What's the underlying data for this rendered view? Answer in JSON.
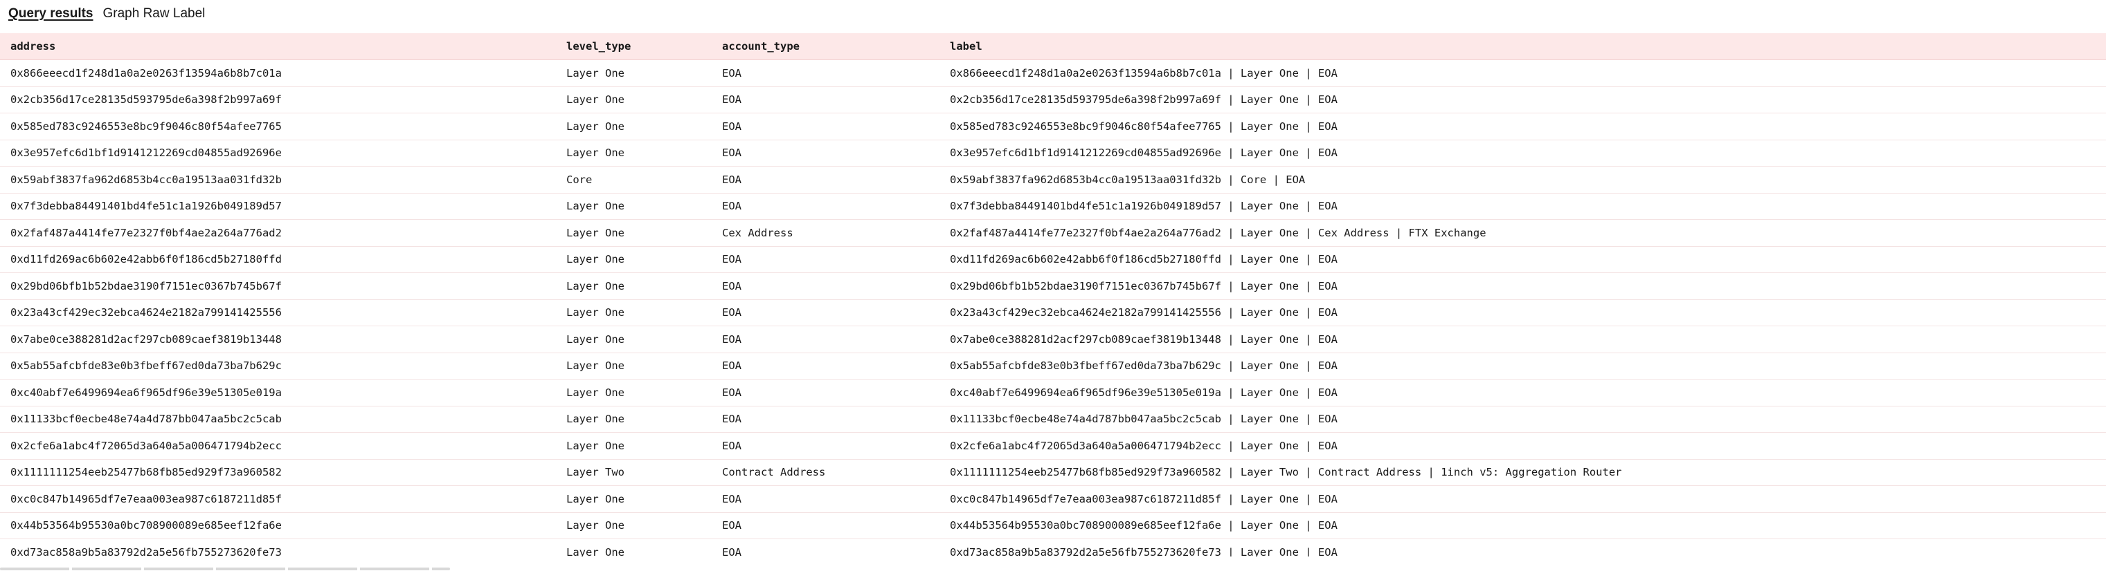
{
  "tabs": [
    {
      "label": "Query results",
      "active": true
    },
    {
      "label": "Graph Raw Label",
      "active": false
    }
  ],
  "table": {
    "columns": [
      "address",
      "level_type",
      "account_type",
      "label"
    ],
    "rows": [
      [
        "0x866eeecd1f248d1a0a2e0263f13594a6b8b7c01a",
        "Layer One",
        "EOA",
        "0x866eeecd1f248d1a0a2e0263f13594a6b8b7c01a | Layer One | EOA"
      ],
      [
        "0x2cb356d17ce28135d593795de6a398f2b997a69f",
        "Layer One",
        "EOA",
        "0x2cb356d17ce28135d593795de6a398f2b997a69f | Layer One | EOA"
      ],
      [
        "0x585ed783c9246553e8bc9f9046c80f54afee7765",
        "Layer One",
        "EOA",
        "0x585ed783c9246553e8bc9f9046c80f54afee7765 | Layer One | EOA"
      ],
      [
        "0x3e957efc6d1bf1d9141212269cd04855ad92696e",
        "Layer One",
        "EOA",
        "0x3e957efc6d1bf1d9141212269cd04855ad92696e | Layer One | EOA"
      ],
      [
        "0x59abf3837fa962d6853b4cc0a19513aa031fd32b",
        "Core",
        "EOA",
        "0x59abf3837fa962d6853b4cc0a19513aa031fd32b | Core | EOA"
      ],
      [
        "0x7f3debba84491401bd4fe51c1a1926b049189d57",
        "Layer One",
        "EOA",
        "0x7f3debba84491401bd4fe51c1a1926b049189d57 | Layer One | EOA"
      ],
      [
        "0x2faf487a4414fe77e2327f0bf4ae2a264a776ad2",
        "Layer One",
        "Cex Address",
        "0x2faf487a4414fe77e2327f0bf4ae2a264a776ad2 | Layer One | Cex Address | FTX Exchange"
      ],
      [
        "0xd11fd269ac6b602e42abb6f0f186cd5b27180ffd",
        "Layer One",
        "EOA",
        "0xd11fd269ac6b602e42abb6f0f186cd5b27180ffd | Layer One | EOA"
      ],
      [
        "0x29bd06bfb1b52bdae3190f7151ec0367b745b67f",
        "Layer One",
        "EOA",
        "0x29bd06bfb1b52bdae3190f7151ec0367b745b67f | Layer One | EOA"
      ],
      [
        "0x23a43cf429ec32ebca4624e2182a799141425556",
        "Layer One",
        "EOA",
        "0x23a43cf429ec32ebca4624e2182a799141425556 | Layer One | EOA"
      ],
      [
        "0x7abe0ce388281d2acf297cb089caef3819b13448",
        "Layer One",
        "EOA",
        "0x7abe0ce388281d2acf297cb089caef3819b13448 | Layer One | EOA"
      ],
      [
        "0x5ab55afcbfde83e0b3fbeff67ed0da73ba7b629c",
        "Layer One",
        "EOA",
        "0x5ab55afcbfde83e0b3fbeff67ed0da73ba7b629c | Layer One | EOA"
      ],
      [
        "0xc40abf7e6499694ea6f965df96e39e51305e019a",
        "Layer One",
        "EOA",
        "0xc40abf7e6499694ea6f965df96e39e51305e019a | Layer One | EOA"
      ],
      [
        "0x11133bcf0ecbe48e74a4d787bb047aa5bc2c5cab",
        "Layer One",
        "EOA",
        "0x11133bcf0ecbe48e74a4d787bb047aa5bc2c5cab | Layer One | EOA"
      ],
      [
        "0x2cfe6a1abc4f72065d3a640a5a006471794b2ecc",
        "Layer One",
        "EOA",
        "0x2cfe6a1abc4f72065d3a640a5a006471794b2ecc | Layer One | EOA"
      ],
      [
        "0x1111111254eeb25477b68fb85ed929f73a960582",
        "Layer Two",
        "Contract Address",
        "0x1111111254eeb25477b68fb85ed929f73a960582 | Layer Two | Contract Address | 1inch v5: Aggregation Router"
      ],
      [
        "0xc0c847b14965df7e7eaa003ea987c6187211d85f",
        "Layer One",
        "EOA",
        "0xc0c847b14965df7e7eaa003ea987c6187211d85f | Layer One | EOA"
      ],
      [
        "0x44b53564b95530a0bc708900089e685eef12fa6e",
        "Layer One",
        "EOA",
        "0x44b53564b95530a0bc708900089e685eef12fa6e | Layer One | EOA"
      ],
      [
        "0xd73ac858a9b5a83792d2a5e56fb755273620fe73",
        "Layer One",
        "EOA",
        "0xd73ac858a9b5a83792d2a5e56fb755273620fe73 | Layer One | EOA"
      ]
    ]
  }
}
